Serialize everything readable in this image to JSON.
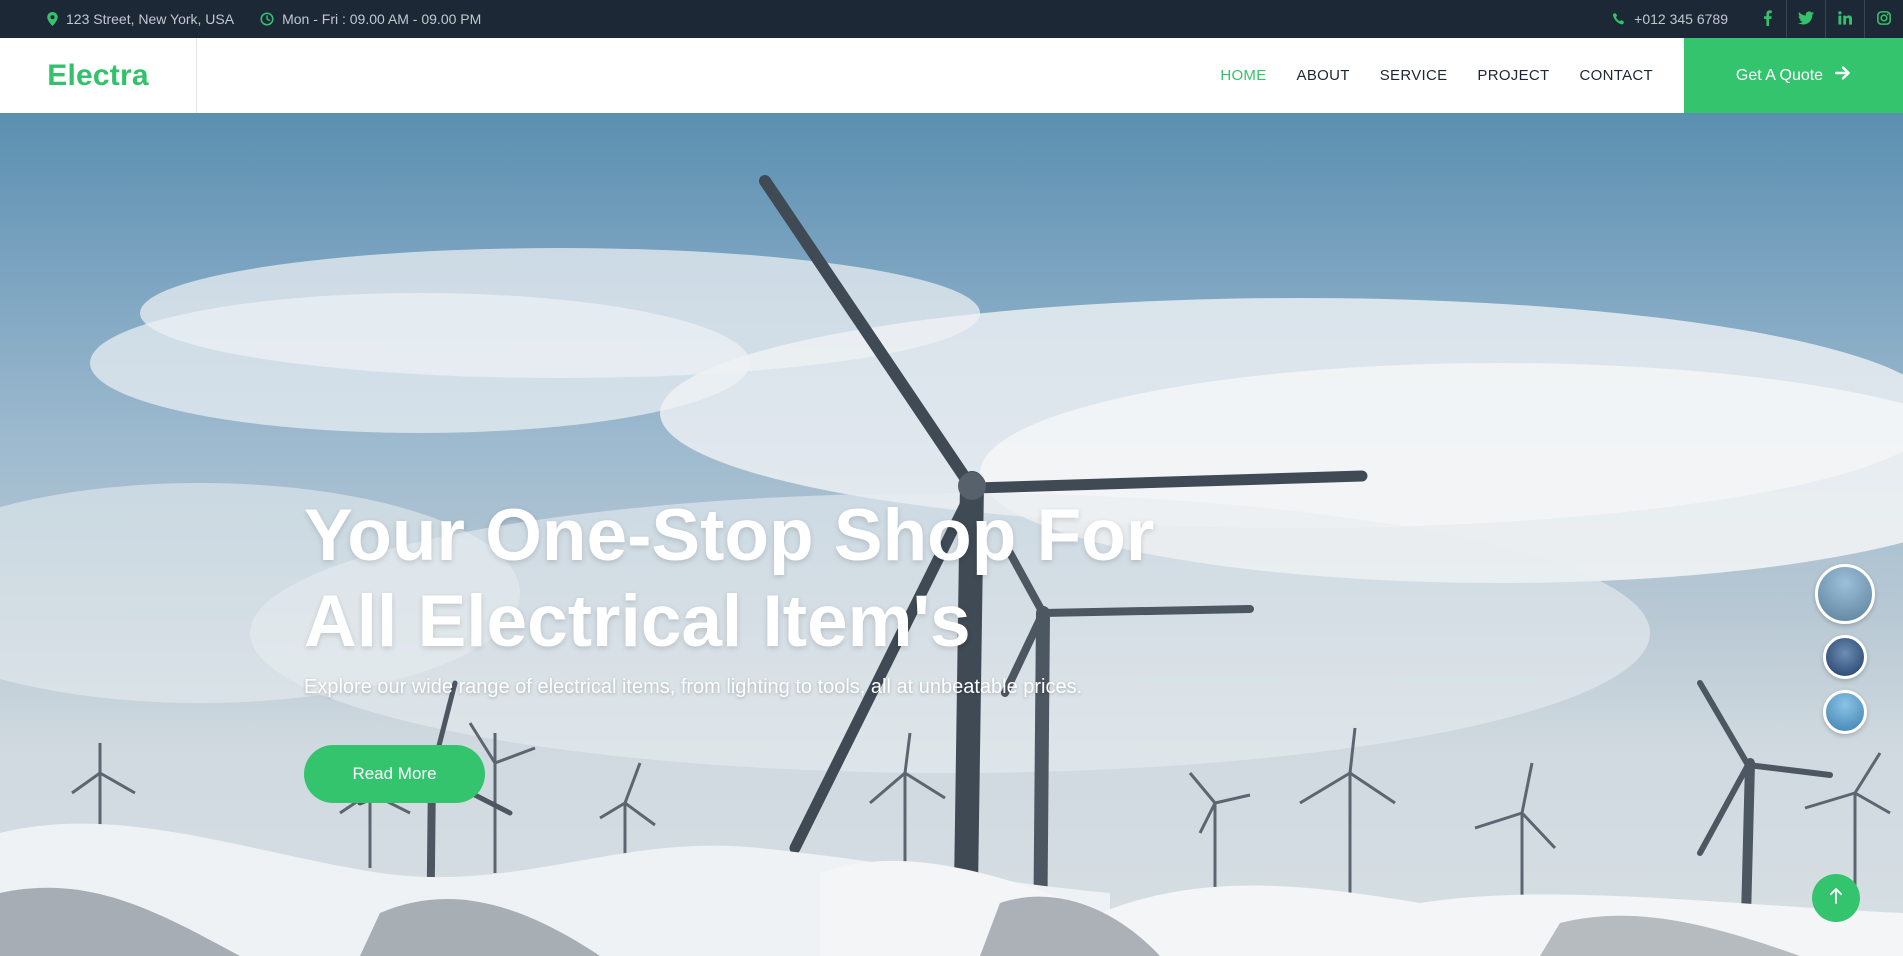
{
  "topbar": {
    "address": "123 Street, New York, USA",
    "hours": "Mon - Fri : 09.00 AM - 09.00 PM",
    "phone": "+012 345 6789",
    "socials": [
      "facebook-icon",
      "twitter-icon",
      "linkedin-icon",
      "instagram-icon"
    ]
  },
  "navbar": {
    "brand": "Electra",
    "menu": [
      "HOME",
      "ABOUT",
      "SERVICE",
      "PROJECT",
      "CONTACT"
    ],
    "active": "HOME",
    "quote_button": "Get A Quote"
  },
  "hero": {
    "title_line1": "Your One-Stop Shop For",
    "title_line2": "All Electrical Item's",
    "subtitle": "Explore our wide range of electrical items, from lighting to tools, all at unbeatable prices.",
    "button": "Read More"
  },
  "colors": {
    "accent": "#35c46e",
    "topbar_bg": "#1c2836"
  }
}
